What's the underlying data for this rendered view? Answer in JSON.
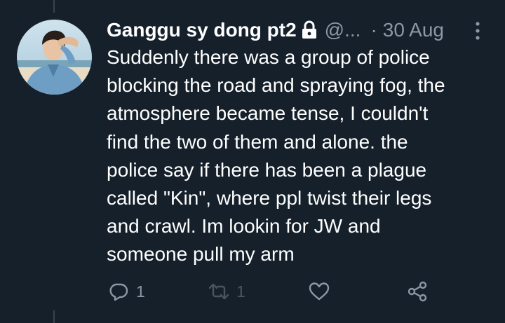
{
  "tweet": {
    "display_name": "Ganggu sy dong pt2",
    "handle": "@...",
    "separator": "·",
    "date": "30 Aug",
    "text": "Suddenly there was a group of police\nblocking the road and spraying fog, the\natmosphere became tense, I couldn't\nfind the two of them and alone. the\npolice say if there has been a plague\ncalled \"Kin\", where ppl twist their legs\nand crawl. Im lookin for JW and\nsomeone pull my arm",
    "protected": true
  },
  "actions": {
    "reply_count": "1",
    "retweet_count": "1",
    "like_count": "",
    "icons": [
      "reply-icon",
      "retweet-icon",
      "like-icon",
      "share-icon"
    ]
  },
  "colors": {
    "background": "#15202b",
    "primary_text": "#ffffff",
    "secondary_text": "#8b98a5",
    "thread_line": "#38444d"
  }
}
